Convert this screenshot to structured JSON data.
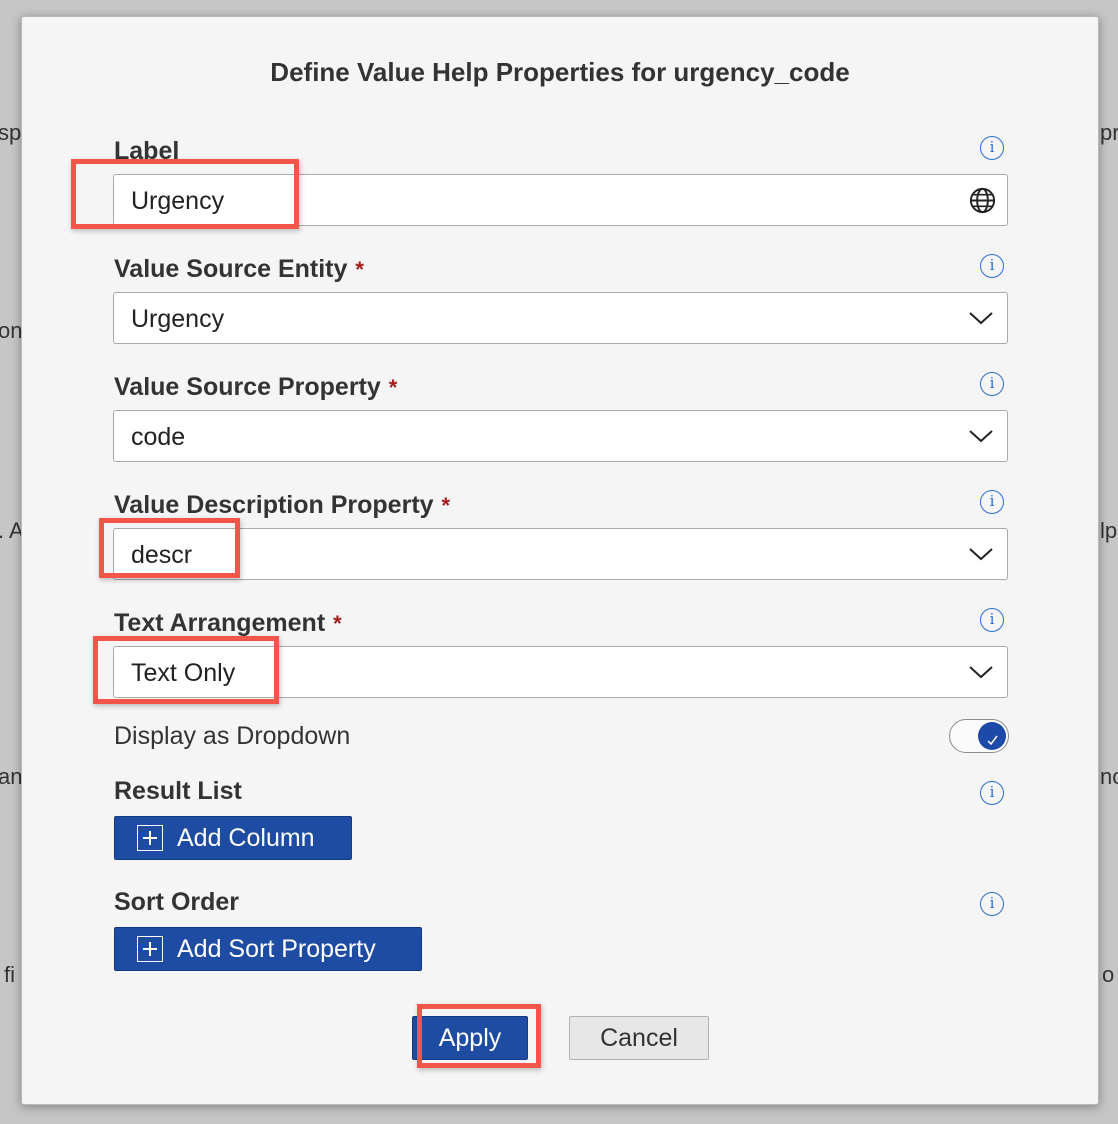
{
  "background_fragments": [
    "sp",
    "on",
    ". A",
    "an",
    "fi",
    "pr",
    "lp",
    "nc",
    "o"
  ],
  "dialog": {
    "title": "Define Value Help Properties for urgency_code",
    "info_glyph": "i",
    "fields": {
      "label": {
        "label": "Label",
        "value": "Urgency",
        "icon": "globe-icon"
      },
      "value_source_entity": {
        "label": "Value Source Entity",
        "required_mark": "*",
        "value": "Urgency"
      },
      "value_source_property": {
        "label": "Value Source Property",
        "required_mark": "*",
        "value": "code"
      },
      "value_description_property": {
        "label": "Value Description Property",
        "required_mark": "*",
        "value": "descr"
      },
      "text_arrangement": {
        "label": "Text Arrangement",
        "required_mark": "*",
        "value": "Text Only"
      }
    },
    "display_as_dropdown": {
      "label": "Display as Dropdown",
      "enabled": true
    },
    "result_list": {
      "label": "Result List",
      "button": "Add Column"
    },
    "sort_order": {
      "label": "Sort Order",
      "button": "Add Sort Property"
    },
    "buttons": {
      "apply": "Apply",
      "cancel": "Cancel"
    }
  },
  "colors": {
    "primary_button": "#1f4ca3",
    "info_icon": "#2a6cd6",
    "required_mark": "#a61c1c",
    "highlight": "#f4554a"
  }
}
